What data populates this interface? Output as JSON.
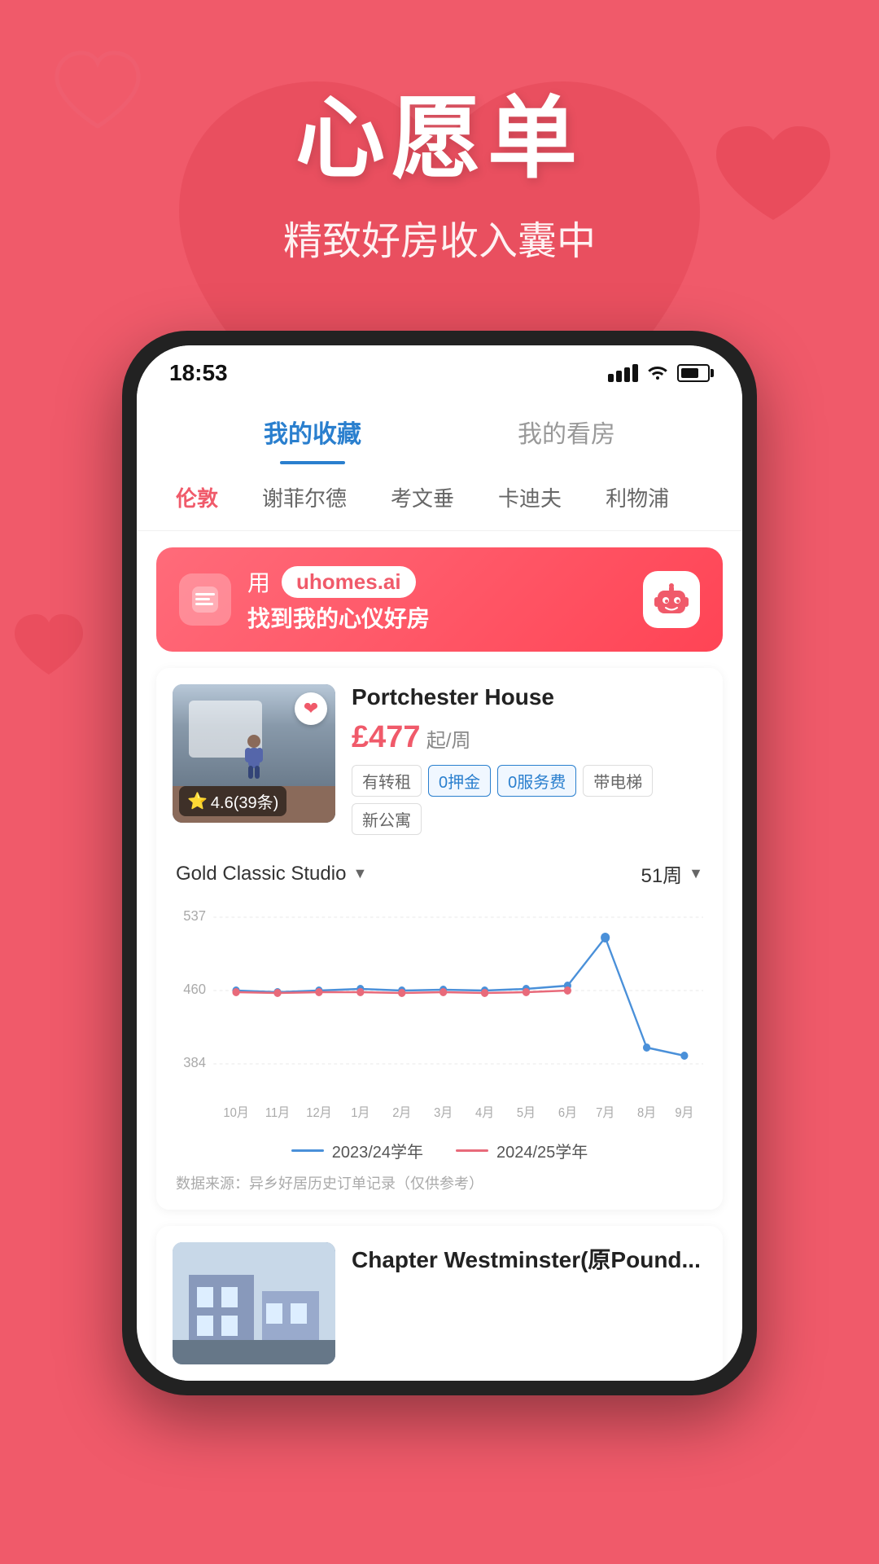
{
  "app": {
    "background_color": "#f05a6a"
  },
  "header": {
    "title": "心愿单",
    "subtitle": "精致好房收入囊中"
  },
  "phone": {
    "status_bar": {
      "time": "18:53"
    },
    "tabs": [
      {
        "label": "我的收藏",
        "active": true
      },
      {
        "label": "我的看房",
        "active": false
      }
    ],
    "cities": [
      {
        "label": "伦敦",
        "active": true
      },
      {
        "label": "谢菲尔德",
        "active": false
      },
      {
        "label": "考文垂",
        "active": false
      },
      {
        "label": "卡迪夫",
        "active": false
      },
      {
        "label": "利物浦",
        "active": false
      }
    ],
    "ai_banner": {
      "use_text": "用",
      "domain": "uhomes.ai",
      "subtitle": "找到我的心仪好房"
    },
    "property1": {
      "name": "Portchester House",
      "price": "£477",
      "price_suffix": "起/周",
      "rating": "4.6(39条)",
      "tags": [
        {
          "label": "有转租",
          "type": "normal"
        },
        {
          "label": "0押金",
          "type": "blue"
        },
        {
          "label": "0服务费",
          "type": "blue"
        },
        {
          "label": "带电梯",
          "type": "normal"
        },
        {
          "label": "新公寓",
          "type": "normal"
        }
      ]
    },
    "chart": {
      "room_type": "Gold Classic Studio",
      "weeks": "51周",
      "y_max": "537",
      "y_mid": "460",
      "y_min": "384",
      "x_labels": [
        "10月",
        "11月",
        "12月",
        "1月",
        "2月",
        "3月",
        "4月",
        "5月",
        "6月",
        "7月",
        "8月",
        "9月"
      ],
      "legend": [
        {
          "label": "2023/24学年",
          "color": "#4a90d9"
        },
        {
          "label": "2024/25学年",
          "color": "#e86a7a"
        }
      ],
      "note": "数据来源：异乡好居历史订单记录（仅供参考）"
    },
    "property2": {
      "name": "Chapter Westminster(原Pound..."
    }
  }
}
